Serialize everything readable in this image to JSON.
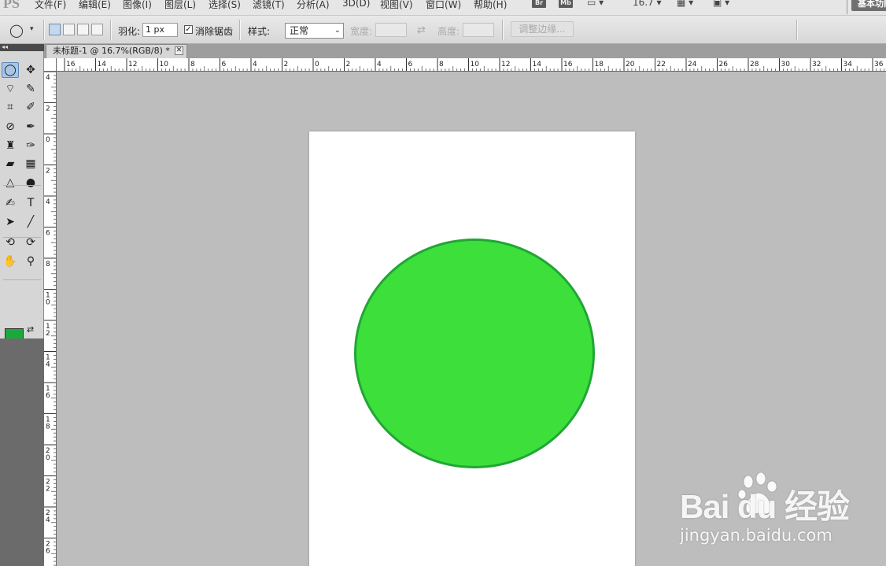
{
  "app_logo": "PS",
  "menu": [
    "文件(F)",
    "编辑(E)",
    "图像(I)",
    "图层(L)",
    "选择(S)",
    "滤镜(T)",
    "分析(A)",
    "3D(D)",
    "视图(V)",
    "窗口(W)",
    "帮助(H)"
  ],
  "menubar_right": {
    "bridge_label": "Br",
    "minibridge_label": "Mb",
    "zoom_value": "16.7",
    "workspace_label": "基本功能"
  },
  "options": {
    "feather_label": "羽化:",
    "feather_value": "1 px",
    "antialias_label": "消除锯齿",
    "antialias_checked": true,
    "style_label": "样式:",
    "style_value": "正常",
    "width_label": "宽度:",
    "height_label": "高度:",
    "swap_glyph": "⇄",
    "refine_edge_label": "调整边缘..."
  },
  "toolbox": {
    "collapse_glyph": "◂◂",
    "foreground_color": "#1aaa3c",
    "background_color": "#ffffff",
    "tools": [
      {
        "name": "elliptical-marquee",
        "glyph": "◯"
      },
      {
        "name": "move",
        "glyph": "✥"
      },
      {
        "name": "polygonal-lasso",
        "glyph": "⌔"
      },
      {
        "name": "quick-selection",
        "glyph": "✎"
      },
      {
        "name": "crop",
        "glyph": "⌗"
      },
      {
        "name": "eyedropper",
        "glyph": "✐"
      },
      {
        "name": "spot-healing",
        "glyph": "⊘"
      },
      {
        "name": "brush",
        "glyph": "✒"
      },
      {
        "name": "clone-stamp",
        "glyph": "♜"
      },
      {
        "name": "history-brush",
        "glyph": "✑"
      },
      {
        "name": "eraser",
        "glyph": "▰"
      },
      {
        "name": "gradient",
        "glyph": "▦"
      },
      {
        "name": "blur",
        "glyph": "△"
      },
      {
        "name": "dodge",
        "glyph": "●"
      },
      {
        "name": "pen",
        "glyph": "✍"
      },
      {
        "name": "type",
        "glyph": "T"
      },
      {
        "name": "path-selection",
        "glyph": "➤"
      },
      {
        "name": "line",
        "glyph": "╱"
      },
      {
        "name": "3d-rotate",
        "glyph": "⟲"
      },
      {
        "name": "3d-orbit",
        "glyph": "⟳"
      },
      {
        "name": "hand",
        "glyph": "✋"
      },
      {
        "name": "zoom",
        "glyph": "⚲"
      }
    ]
  },
  "document": {
    "tab_title": "未标题-1 @ 16.7%(RGB/8) *",
    "close_glyph": "✕"
  },
  "ruler_top_labels": [
    "16",
    "14",
    "12",
    "10",
    "8",
    "6",
    "4",
    "2",
    "0",
    "2",
    "4",
    "6",
    "8",
    "10",
    "12",
    "14",
    "16",
    "18",
    "20",
    "22",
    "24",
    "26",
    "28",
    "30",
    "32",
    "34",
    "36"
  ],
  "ruler_left_labels": [
    "4",
    "2",
    "0",
    "2",
    "4",
    "6",
    "8",
    "10",
    "12",
    "14",
    "16",
    "18",
    "20",
    "22",
    "24",
    "26"
  ],
  "canvas": {
    "circle_fill": "#3de03a",
    "circle_stroke": "#21a636"
  },
  "watermark": {
    "logo": "Bai  du 经验",
    "url": "jingyan.baidu.com"
  }
}
